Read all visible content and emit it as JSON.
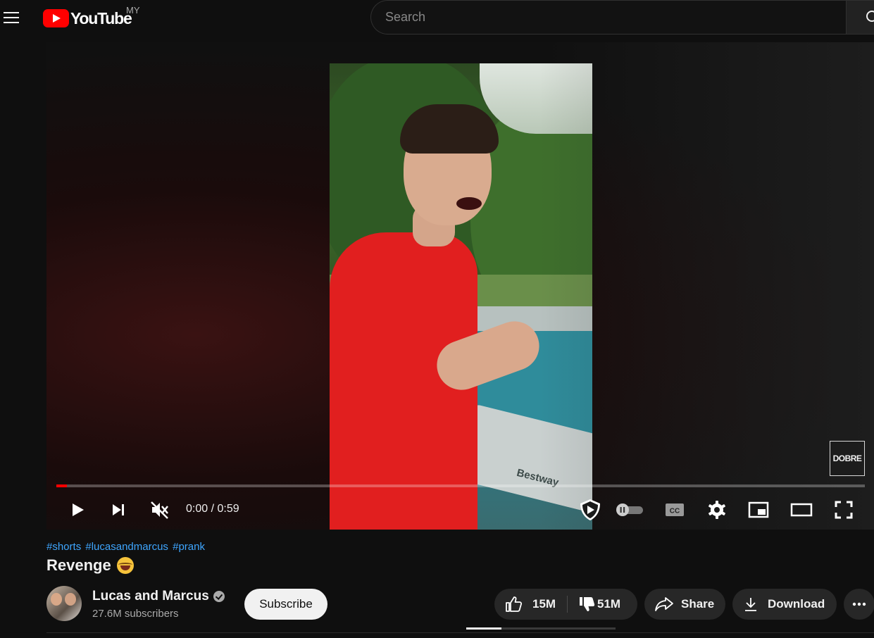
{
  "header": {
    "logo_text": "YouTube",
    "country_code": "MY",
    "search_placeholder": "Search"
  },
  "player": {
    "watermark": "DOBRE",
    "video_float_text": "Bestway",
    "time_current": "0:00",
    "time_separator": " / ",
    "time_duration": "0:59",
    "progress_played_fraction": 0.013,
    "controls": [
      "play",
      "next",
      "mute",
      "sponsorblock",
      "autoplay",
      "subtitles",
      "settings",
      "miniplayer",
      "theater",
      "fullscreen"
    ]
  },
  "video": {
    "hashtags": [
      "#shorts",
      "#lucasandmarcus",
      "#prank"
    ],
    "title": "Revenge",
    "title_emoji": "rolling-on-floor-laughing"
  },
  "channel": {
    "name": "Lucas and Marcus",
    "subscribers": "27.6M subscribers",
    "subscribe_label": "Subscribe"
  },
  "actions": {
    "likes": "15M",
    "dislikes": "51M",
    "share_label": "Share",
    "download_label": "Download"
  },
  "colors": {
    "accent": "#ff0000",
    "link": "#3ea6ff",
    "background": "#0f0f0f"
  }
}
